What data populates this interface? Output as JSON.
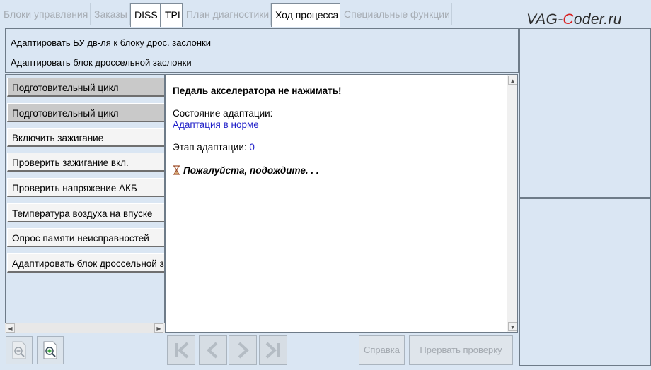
{
  "tabs": [
    {
      "label": "Блоки управления",
      "active": false
    },
    {
      "label": "Заказы",
      "active": false
    },
    {
      "label": "DISS",
      "active": true
    },
    {
      "label": "TPI",
      "active": true
    },
    {
      "label": "План диагностики",
      "active": false
    },
    {
      "label": "Ход процесса",
      "active": true
    },
    {
      "label": "Специальные функции",
      "active": false
    }
  ],
  "logo": {
    "part1": "VAG-",
    "part2": "C",
    "part3": "oder.ru"
  },
  "header": {
    "line1": "Адаптировать БУ дв-ля к блоку дрос. заслонки",
    "line2": "Адаптировать блок дроссельной заслонки"
  },
  "steps": [
    {
      "label": "Подготовительный цикл",
      "done": true
    },
    {
      "label": "Подготовительный цикл",
      "done": true
    },
    {
      "label": "Включить зажигание",
      "done": false
    },
    {
      "label": "Проверить зажигание вкл.",
      "done": false
    },
    {
      "label": "Проверить напряжение АКБ",
      "done": false
    },
    {
      "label": "Температура воздуха на впуске",
      "done": false
    },
    {
      "label": "Опрос памяти неисправностей",
      "done": false
    },
    {
      "label": "Адаптировать блок дроссельной заслонки",
      "done": false
    }
  ],
  "main": {
    "warning": "Педаль акселератора не нажимать!",
    "state_label": "Состояние адаптации:",
    "state_value": "Адаптация в норме",
    "stage_label": "Этап адаптации:",
    "stage_value": "0",
    "wait": "Пожалуйста, подождите. . ."
  },
  "buttons": {
    "help": "Справка",
    "abort": "Прервать проверку"
  },
  "colors": {
    "background": "#dae6f3",
    "value_blue": "#1e1ec8",
    "logo_red": "#d81e1e",
    "disabled_text": "#a6acb3"
  },
  "icons": {
    "zoom_out": "zoom-out-icon",
    "zoom_in": "zoom-in-icon",
    "first": "first-page-icon",
    "prev": "previous-icon",
    "next": "next-icon",
    "last": "last-page-icon",
    "hourglass": "hourglass-icon"
  }
}
